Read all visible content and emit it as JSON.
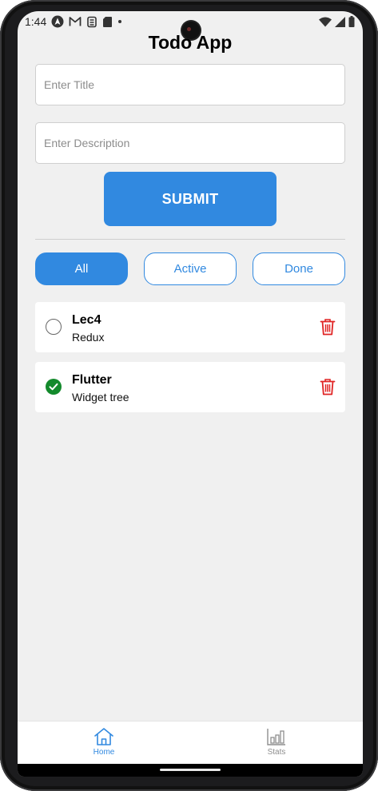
{
  "status_bar": {
    "time": "1:44",
    "left_icons": [
      "android-auto-icon",
      "gmail-icon",
      "keyboard-icon",
      "sd-card-icon",
      "dot-icon"
    ],
    "right_icons": [
      "wifi-icon",
      "signal-icon",
      "battery-icon"
    ]
  },
  "header": {
    "title": "Todo App"
  },
  "form": {
    "title_placeholder": "Enter Title",
    "description_placeholder": "Enter Description",
    "submit_label": "SUBMIT"
  },
  "filters": [
    {
      "label": "All",
      "selected": true
    },
    {
      "label": "Active",
      "selected": false
    },
    {
      "label": "Done",
      "selected": false
    }
  ],
  "todos": [
    {
      "title": "Lec4",
      "description": "Redux",
      "done": false
    },
    {
      "title": "Flutter",
      "description": "Widget tree",
      "done": true
    }
  ],
  "tab_bar": {
    "tabs": [
      {
        "label": "Home",
        "icon": "home-icon",
        "active": true
      },
      {
        "label": "Stats",
        "icon": "stats-icon",
        "active": false
      }
    ]
  },
  "colors": {
    "accent": "#3189e0",
    "delete": "#e02424",
    "done_check": "#138a2c",
    "background": "#f0f0f0"
  }
}
